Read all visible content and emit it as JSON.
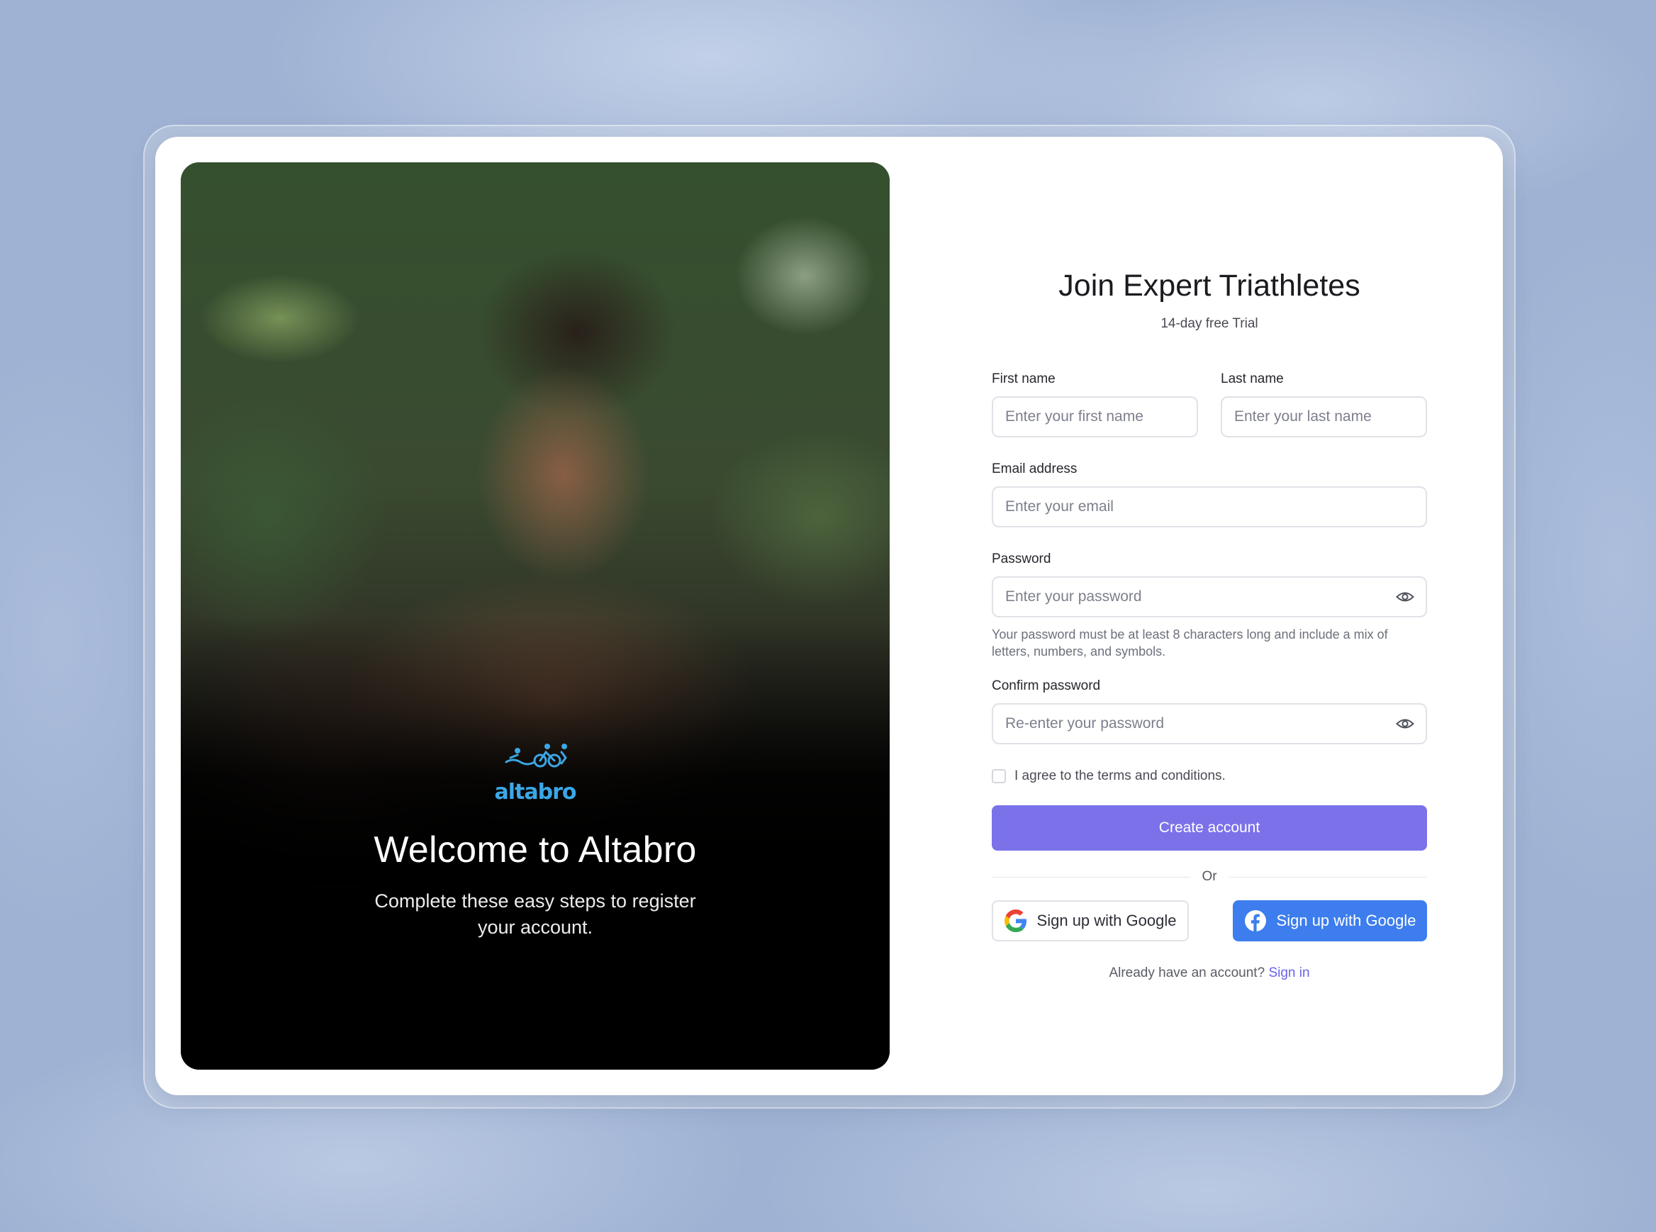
{
  "hero": {
    "logo_text": "altabro",
    "title": "Welcome to Altabro",
    "subtitle": "Complete these easy steps to register your account."
  },
  "form": {
    "title": "Join Expert Triathletes",
    "subtitle": "14-day free Trial",
    "first_name": {
      "label": "First name",
      "placeholder": "Enter your first name"
    },
    "last_name": {
      "label": "Last name",
      "placeholder": "Enter your last name"
    },
    "email": {
      "label": "Email address",
      "placeholder": "Enter your email"
    },
    "password": {
      "label": "Password",
      "placeholder": "Enter your password",
      "hint": "Your password must be at least 8 characters long and include a mix of letters, numbers, and symbols."
    },
    "confirm_password": {
      "label": "Confirm password",
      "placeholder": "Re-enter your password"
    },
    "terms": "I agree to the terms and conditions.",
    "submit": "Create account",
    "divider": "Or",
    "google_button": "Sign up with Google",
    "facebook_button": "Sign up with Google",
    "signin_prompt": "Already have an account?",
    "signin_link": "Sign in"
  },
  "colors": {
    "primary": "#7b72ea",
    "facebook": "#3d7ded",
    "logo": "#3ba7e6",
    "link": "#6a63e8"
  },
  "icons": [
    "eye-icon",
    "google-icon",
    "facebook-icon",
    "altabro-logo-icon"
  ]
}
